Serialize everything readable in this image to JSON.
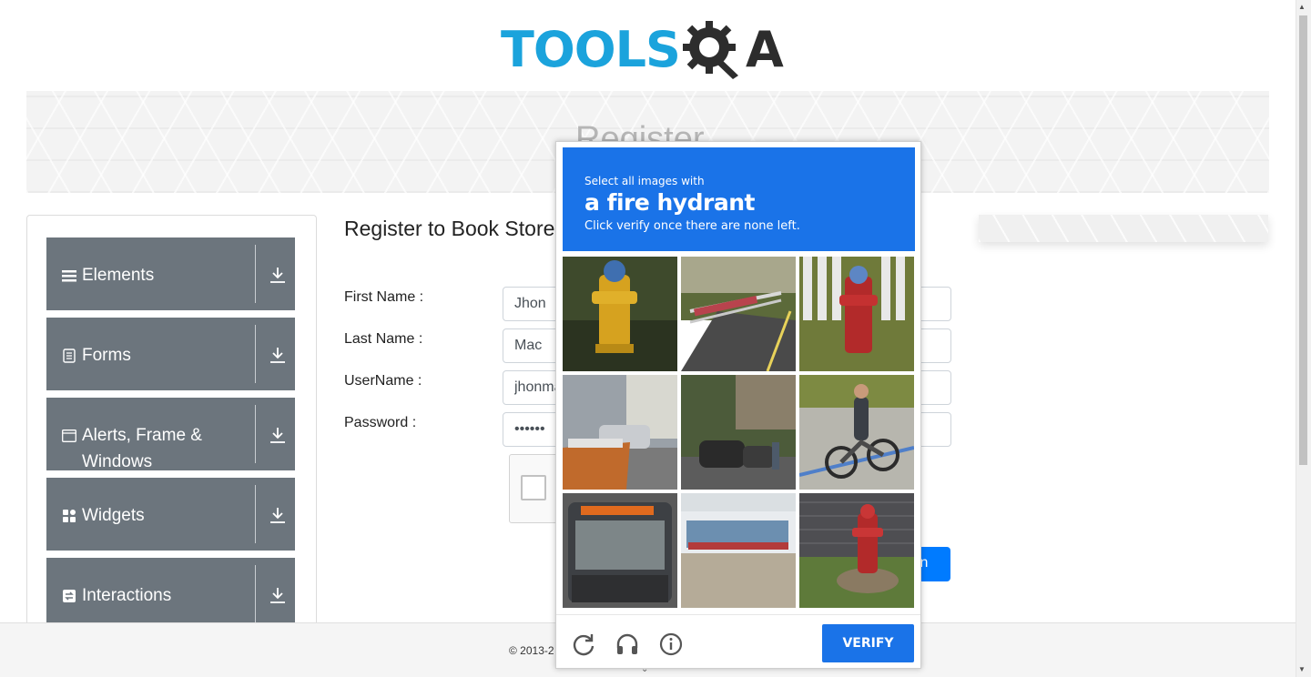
{
  "header": {
    "logo_text": "TOOLS",
    "logo_suffix": "A"
  },
  "banner": {
    "title": "Register"
  },
  "sidebar": {
    "items": [
      {
        "label": "Elements",
        "icon": "hamburger-icon"
      },
      {
        "label": "Forms",
        "icon": "document-icon"
      },
      {
        "label": "Alerts, Frame & Windows",
        "icon": "window-icon"
      },
      {
        "label": "Widgets",
        "icon": "widgets-icon"
      },
      {
        "label": "Interactions",
        "icon": "interactions-icon"
      }
    ]
  },
  "form": {
    "title": "Register to Book Store",
    "first_name_label": "First Name :",
    "first_name_value": "Jhon",
    "last_name_label": "Last Name :",
    "last_name_value": "Mac",
    "username_label": "UserName :",
    "username_value": "jhonmac",
    "password_label": "Password :",
    "password_value": "••••••",
    "login_label": "gin"
  },
  "footer": {
    "text": "© 2013-2"
  },
  "captcha": {
    "prompt": "Select all images with",
    "target": "a fire hydrant",
    "instruction": "Click verify once there are none left.",
    "verify_label": "VERIFY",
    "tiles": [
      {
        "name": "tile-yellow-hydrant"
      },
      {
        "name": "tile-road-barrier"
      },
      {
        "name": "tile-red-hydrant-fence"
      },
      {
        "name": "tile-street-dumpster"
      },
      {
        "name": "tile-street-cars"
      },
      {
        "name": "tile-cyclist"
      },
      {
        "name": "tile-bus"
      },
      {
        "name": "tile-storefront"
      },
      {
        "name": "tile-red-hydrant-wall"
      }
    ]
  },
  "colors": {
    "brand_blue": "#1ba3dc",
    "captcha_blue": "#1a73e8",
    "nav_gray": "#6c757d",
    "button_blue": "#007bff"
  }
}
